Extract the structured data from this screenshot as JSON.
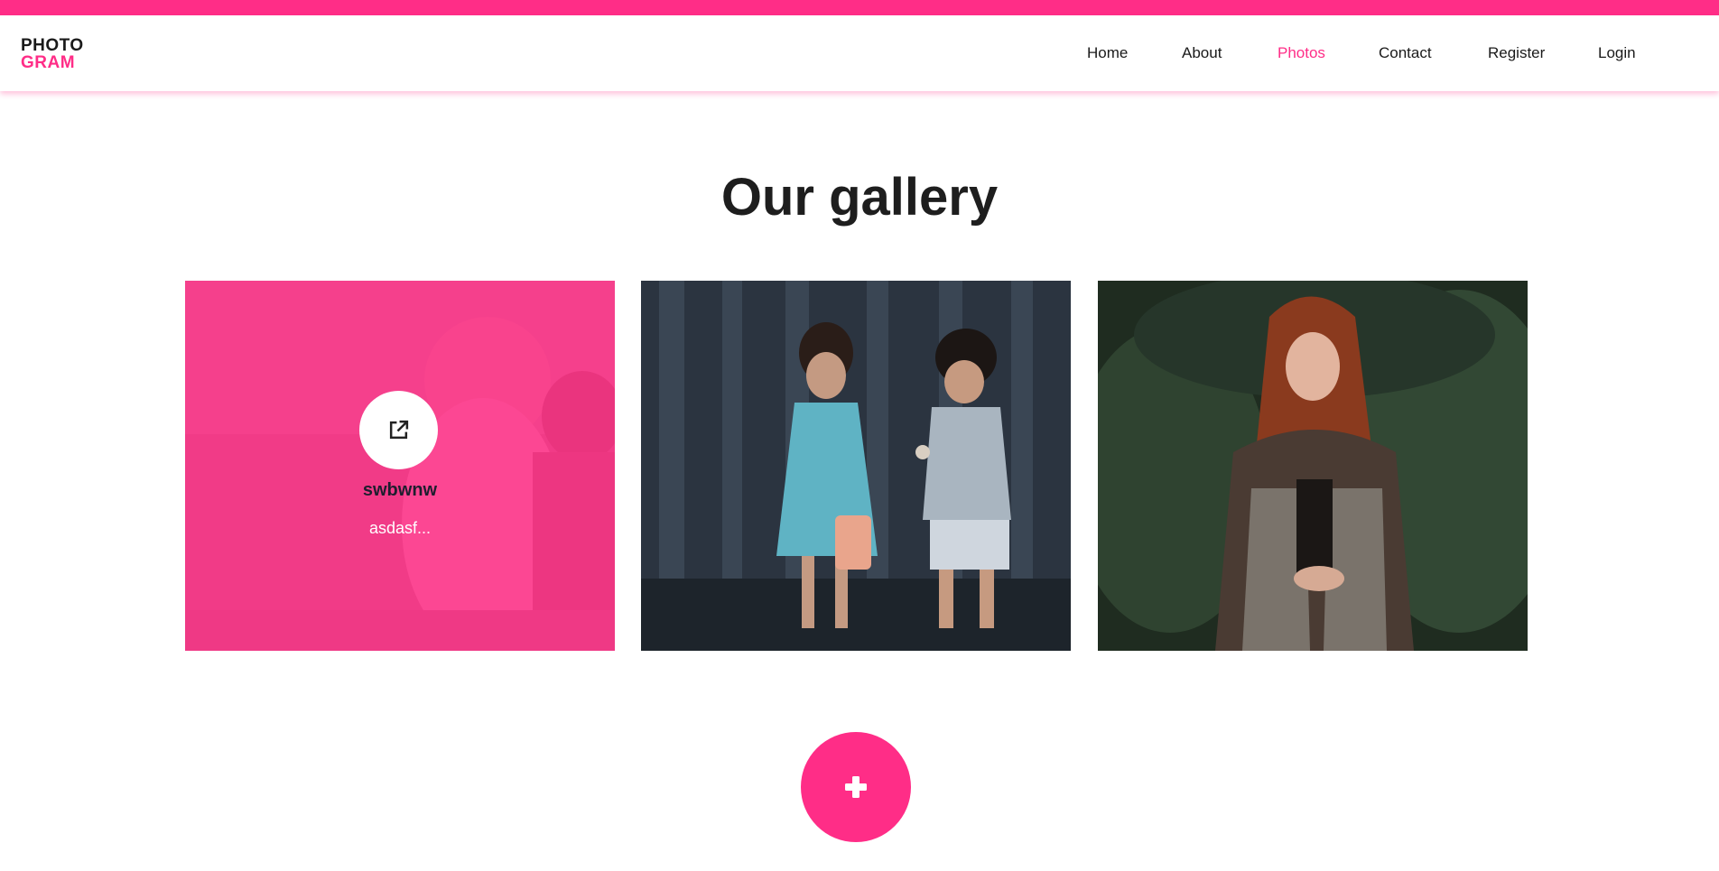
{
  "brand": {
    "line1": "PHOTO",
    "line2": "GRAM",
    "accent_color": "#ff2d87"
  },
  "nav": {
    "items": [
      {
        "label": "Home",
        "active": false
      },
      {
        "label": "About",
        "active": false
      },
      {
        "label": "Photos",
        "active": true
      },
      {
        "label": "Contact",
        "active": false
      },
      {
        "label": "Register",
        "active": false
      },
      {
        "label": "Login",
        "active": false
      }
    ]
  },
  "gallery": {
    "heading": "Our gallery",
    "items": [
      {
        "title": "swbwnw",
        "description": "asdasf...",
        "hovered": true,
        "icon": "external-link-icon"
      },
      {
        "hovered": false
      },
      {
        "hovered": false
      }
    ]
  },
  "add_button": {
    "icon": "plus-icon"
  }
}
